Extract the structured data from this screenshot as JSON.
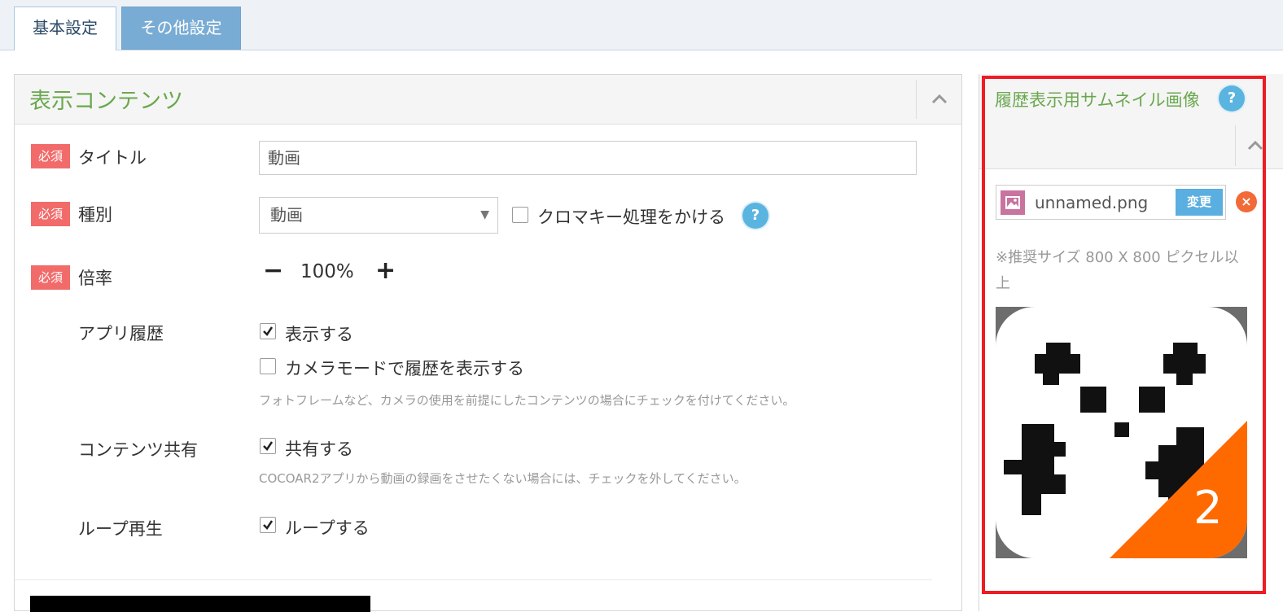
{
  "tabs": [
    {
      "label": "基本設定",
      "active": true
    },
    {
      "label": "その他設定",
      "active": false
    }
  ],
  "main": {
    "title": "表示コンテンツ",
    "required_badge": "必須",
    "title_field": {
      "label": "タイトル",
      "value": "動画"
    },
    "type_field": {
      "label": "種別",
      "value": "動画"
    },
    "chroma_key": {
      "label": "クロマキー処理をかける",
      "checked": false
    },
    "scale": {
      "label": "倍率",
      "minus": "−",
      "value": "100%",
      "plus": "+"
    },
    "app_history": {
      "label": "アプリ履歴",
      "show": {
        "label": "表示する",
        "checked": true
      },
      "camera_mode": {
        "label": "カメラモードで履歴を表示する",
        "checked": false
      },
      "note": "フォトフレームなど、カメラの使用を前提にしたコンテンツの場合にチェックを付けてください。"
    },
    "content_share": {
      "label": "コンテンツ共有",
      "share": {
        "label": "共有する",
        "checked": true
      },
      "note": "COCOAR2アプリから動画の録画をさせたくない場合には、チェックを外してください。"
    },
    "loop": {
      "label": "ループ再生",
      "loop": {
        "label": "ループする",
        "checked": true
      }
    }
  },
  "right": {
    "title": "履歴表示用サムネイル画像",
    "help": "?",
    "file_name": "unnamed.png",
    "change_label": "変更",
    "remove_label": "×",
    "size_note": "※推奨サイズ 800 X 800 ピクセル以上",
    "thumbnail_badge": "2"
  },
  "colors": {
    "accent_green": "#6aa84f",
    "required_red": "#f26b6b",
    "help_blue": "#5ab4e0",
    "tab_blue": "#79acd4",
    "highlight_red": "#ee1c24",
    "thumb_orange": "#ff6a00"
  },
  "icons": [
    "chevron-up-icon",
    "help-icon",
    "check-icon",
    "image-file-icon",
    "close-icon"
  ]
}
